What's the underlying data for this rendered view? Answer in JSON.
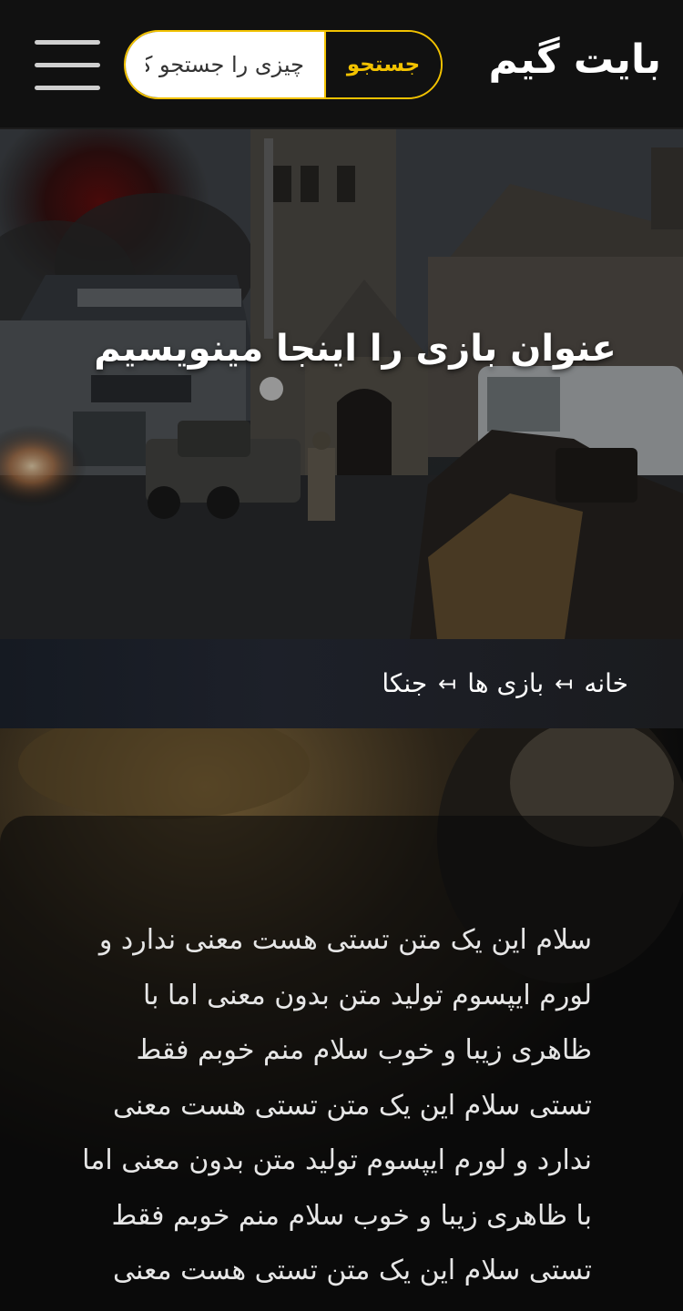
{
  "header": {
    "logo": "بایت گیم",
    "search": {
      "placeholder": "چیزی را جستجو کنید",
      "button_label": "جستجو"
    },
    "menu_icon": "hamburger-menu-icon"
  },
  "hero": {
    "title": "عنوان بازی را اینجا مینویسیم"
  },
  "breadcrumb": {
    "items": [
      "خانه",
      "بازی ها",
      "جنکا"
    ],
    "separator": "↤"
  },
  "content": {
    "paragraph": "سلام این یک متن تستی هست معنی ندارد و لورم ایپسوم تولید متن بدون معنی اما با ظاهری زیبا و خوب سلام منم خوبم فقط تستی سلام این یک متن تستی هست معنی ندارد و لورم ایپسوم تولید متن بدون معنی اما با ظاهری زیبا و خوب سلام منم خوبم فقط تستی سلام این یک متن تستی هست معنی ندارد"
  },
  "colors": {
    "accent": "#f2c200",
    "header_bg": "#111111",
    "page_bg": "#0d0d0d"
  }
}
